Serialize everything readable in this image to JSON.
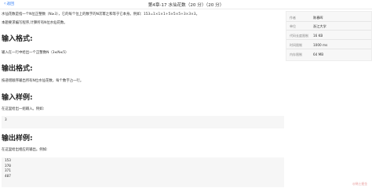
{
  "topbar": {
    "back_label": "返回",
    "title": "第4章-17 水仙花数（20 分）（20 分）"
  },
  "problem": {
    "description_line1": "水仙花数是指一个N位正整数（N≥3），它的每个位上的数字的N次幂之和等于它本身。例如：153=1×1×1+5×5×5+3×3×3。",
    "description_line2": "本题要求编写程序,计算所有N位水仙花数。",
    "input_heading": "输入格式:",
    "input_text": "输入在一行中给出一个正整数N（3≤N≤5）",
    "output_heading": "输出格式:",
    "output_text": "按递增顺序输出所有N位水仙花数，每个数字占一行。",
    "sample_input_heading": "输入样例:",
    "sample_input_caption": "在这里给出一组输入。例如:",
    "sample_input_lines": [
      "3"
    ],
    "sample_output_heading": "输出样例:",
    "sample_output_caption": "在这里给出相应的输出。例如:",
    "sample_output_lines": [
      "153",
      "370",
      "371",
      "407"
    ]
  },
  "info_panel": {
    "rows": [
      {
        "key": "作者",
        "value": "陈春晖"
      },
      {
        "key": "单位",
        "value": "浙江大学"
      },
      {
        "key": "代码长度限制",
        "value": "16 KB"
      },
      {
        "key": "时间限制",
        "value": "1000 ms"
      },
      {
        "key": "内存限制",
        "value": "64 MB"
      }
    ]
  },
  "corner_text": "@稀土掘金"
}
